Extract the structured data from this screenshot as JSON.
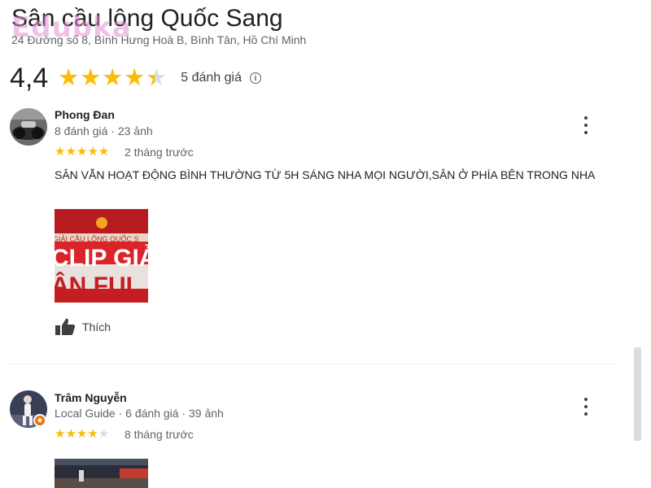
{
  "place": {
    "title": "Sân cầu lông Quốc Sang",
    "address": "24 Đường số 8, Bình Hưng Hoà B, Bình Tân, Hồ Chí Minh",
    "rating": "4,4",
    "rating_value": 4.4,
    "review_count_label": "5 đánh giá"
  },
  "watermark": "Edubka",
  "reviews": [
    {
      "name": "Phong Đan",
      "meta": "8 đánh giá · 23 ảnh",
      "stars": 5,
      "date": "2 tháng trước",
      "text": "SÂN VẪN HOẠT ĐỘNG BÌNH THƯỜNG TỪ 5H SÁNG NHA MỌI NGƯỜI,SÂN Ở PHÍA BÊN TRONG NHA",
      "photo_text_line1": "GIẢI CẦU LÔNG QUỐC S",
      "photo_text_line2": "CLIP GIẢ",
      "photo_text_line3": "ẬN FUL",
      "like_label": "Thích"
    },
    {
      "name": "Trâm Nguyễn",
      "meta": "Local Guide · 6 đánh giá · 39 ảnh",
      "stars": 4,
      "date": "8 tháng trước"
    }
  ],
  "colors": {
    "star": "#fbbc04",
    "star_empty": "#dadce0",
    "local_guide_badge": "#e8710a"
  },
  "icons": {
    "like": "thumbs-up-icon",
    "more": "more-vertical-icon",
    "info": "info-icon"
  }
}
